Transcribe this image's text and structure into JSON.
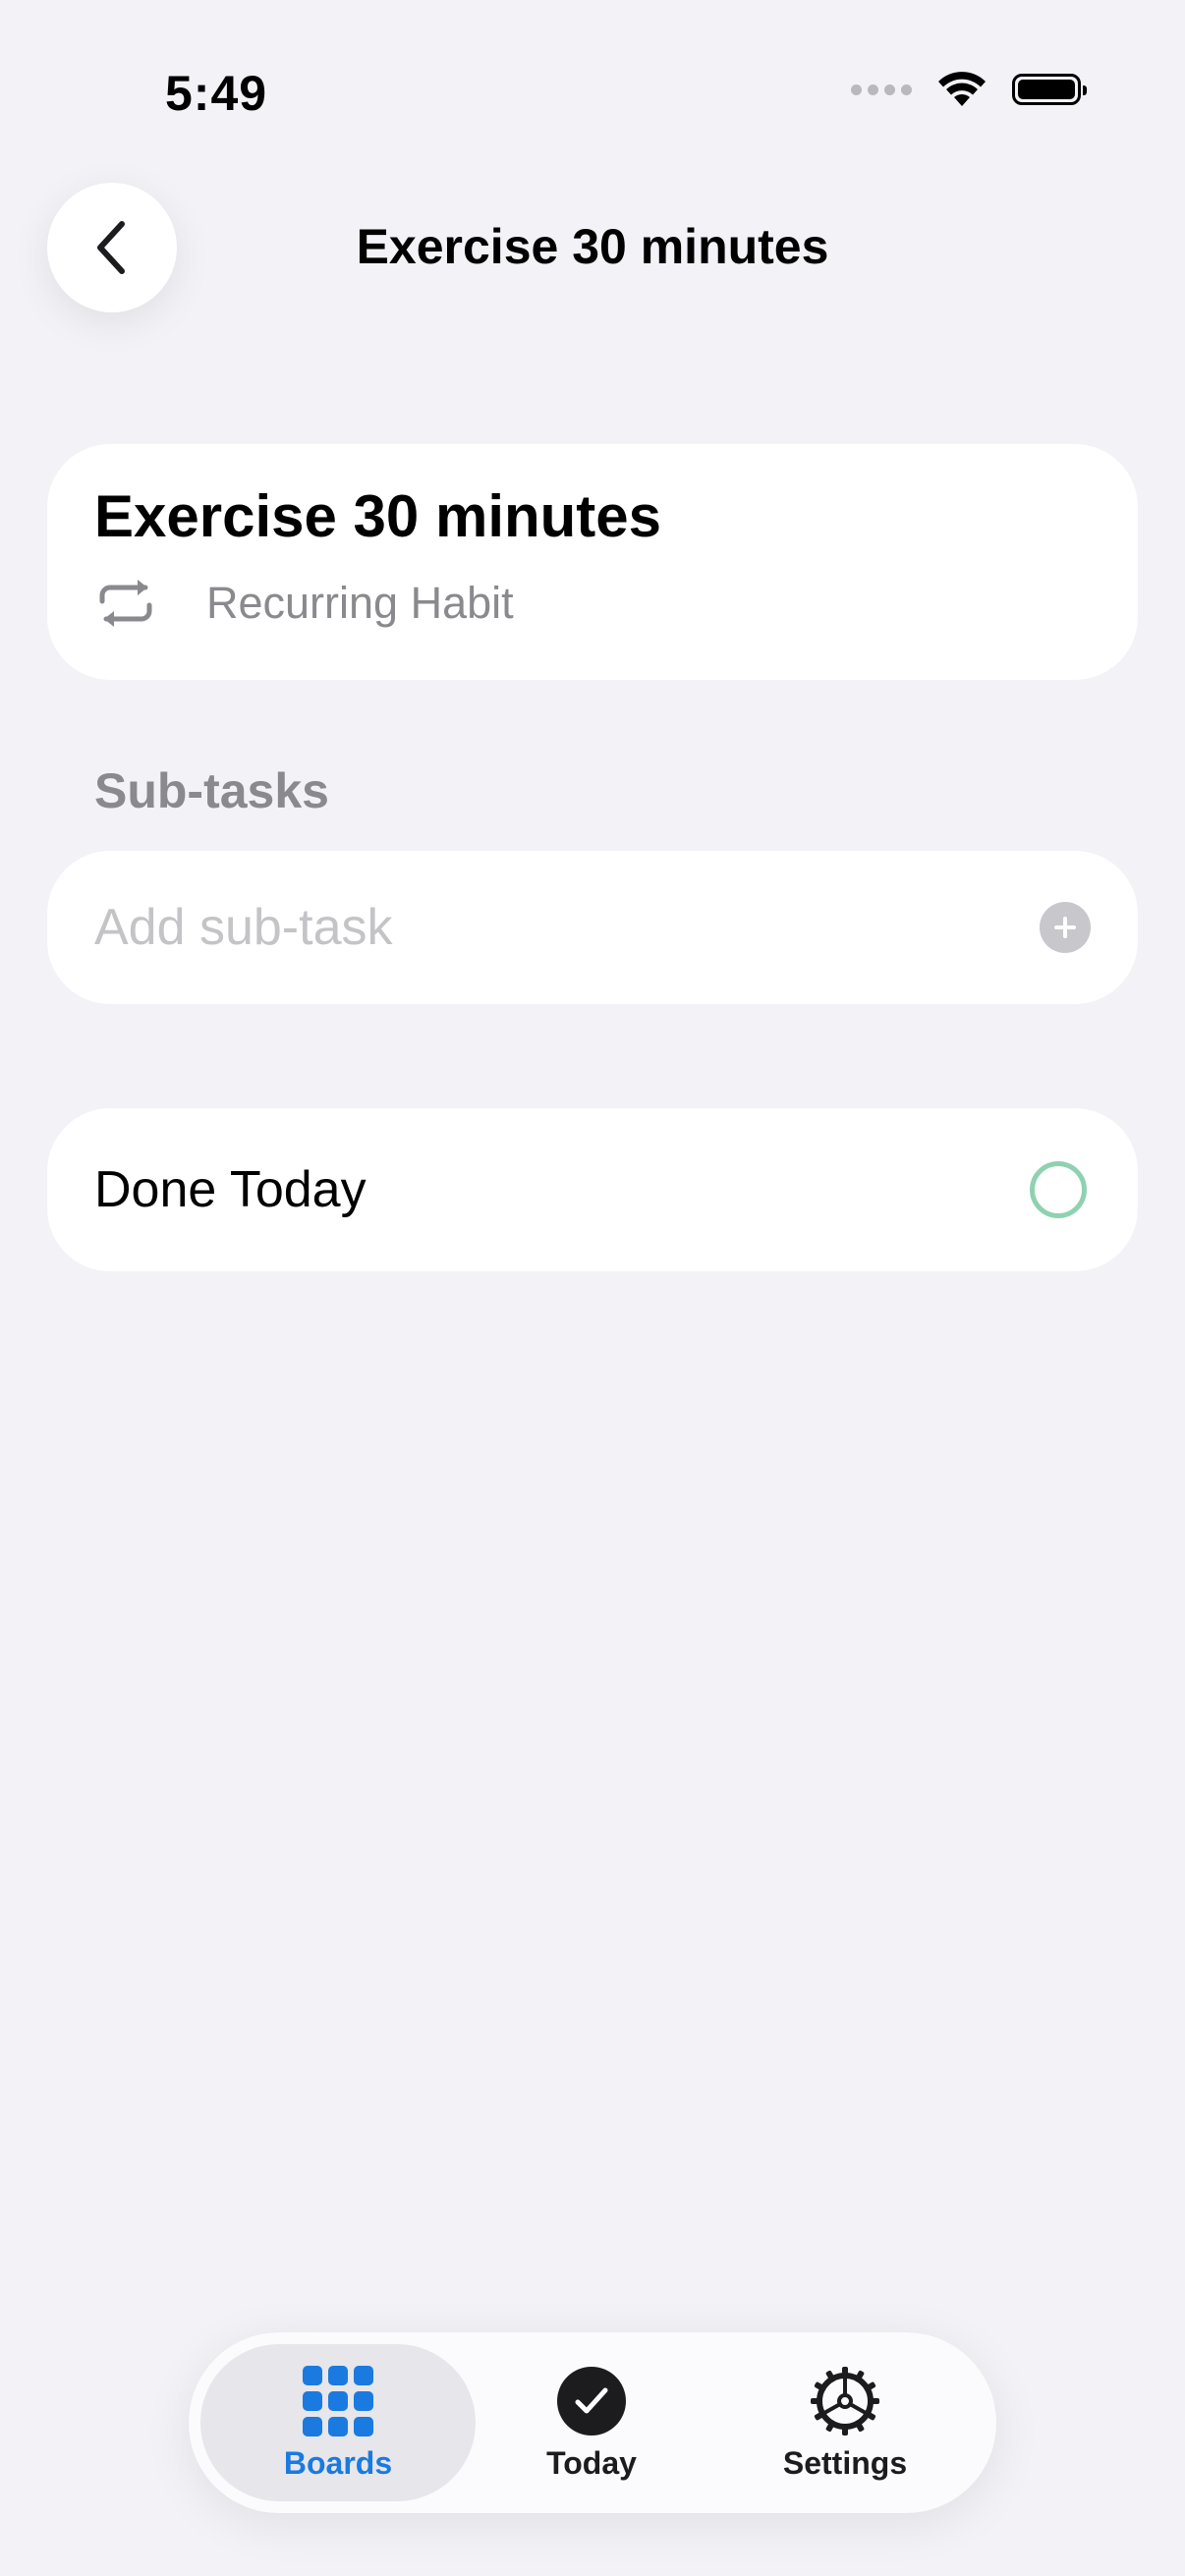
{
  "status_bar": {
    "time": "5:49"
  },
  "nav": {
    "title": "Exercise 30 minutes"
  },
  "habit": {
    "title": "Exercise 30 minutes",
    "type_label": "Recurring Habit"
  },
  "subtasks": {
    "section_label": "Sub-tasks",
    "input_placeholder": "Add sub-task",
    "input_value": ""
  },
  "done_today": {
    "label": "Done Today",
    "checked": false
  },
  "tabbar": {
    "tabs": [
      {
        "label": "Boards",
        "icon": "grid-icon",
        "selected": true
      },
      {
        "label": "Today",
        "icon": "checkmark-circle-icon",
        "selected": false
      },
      {
        "label": "Settings",
        "icon": "gear-icon",
        "selected": false
      }
    ]
  },
  "colors": {
    "background": "#f2f2f7",
    "accent": "#1a7ae0",
    "done_circle": "#8fd1b0",
    "secondary_text": "#8a8a8e"
  }
}
